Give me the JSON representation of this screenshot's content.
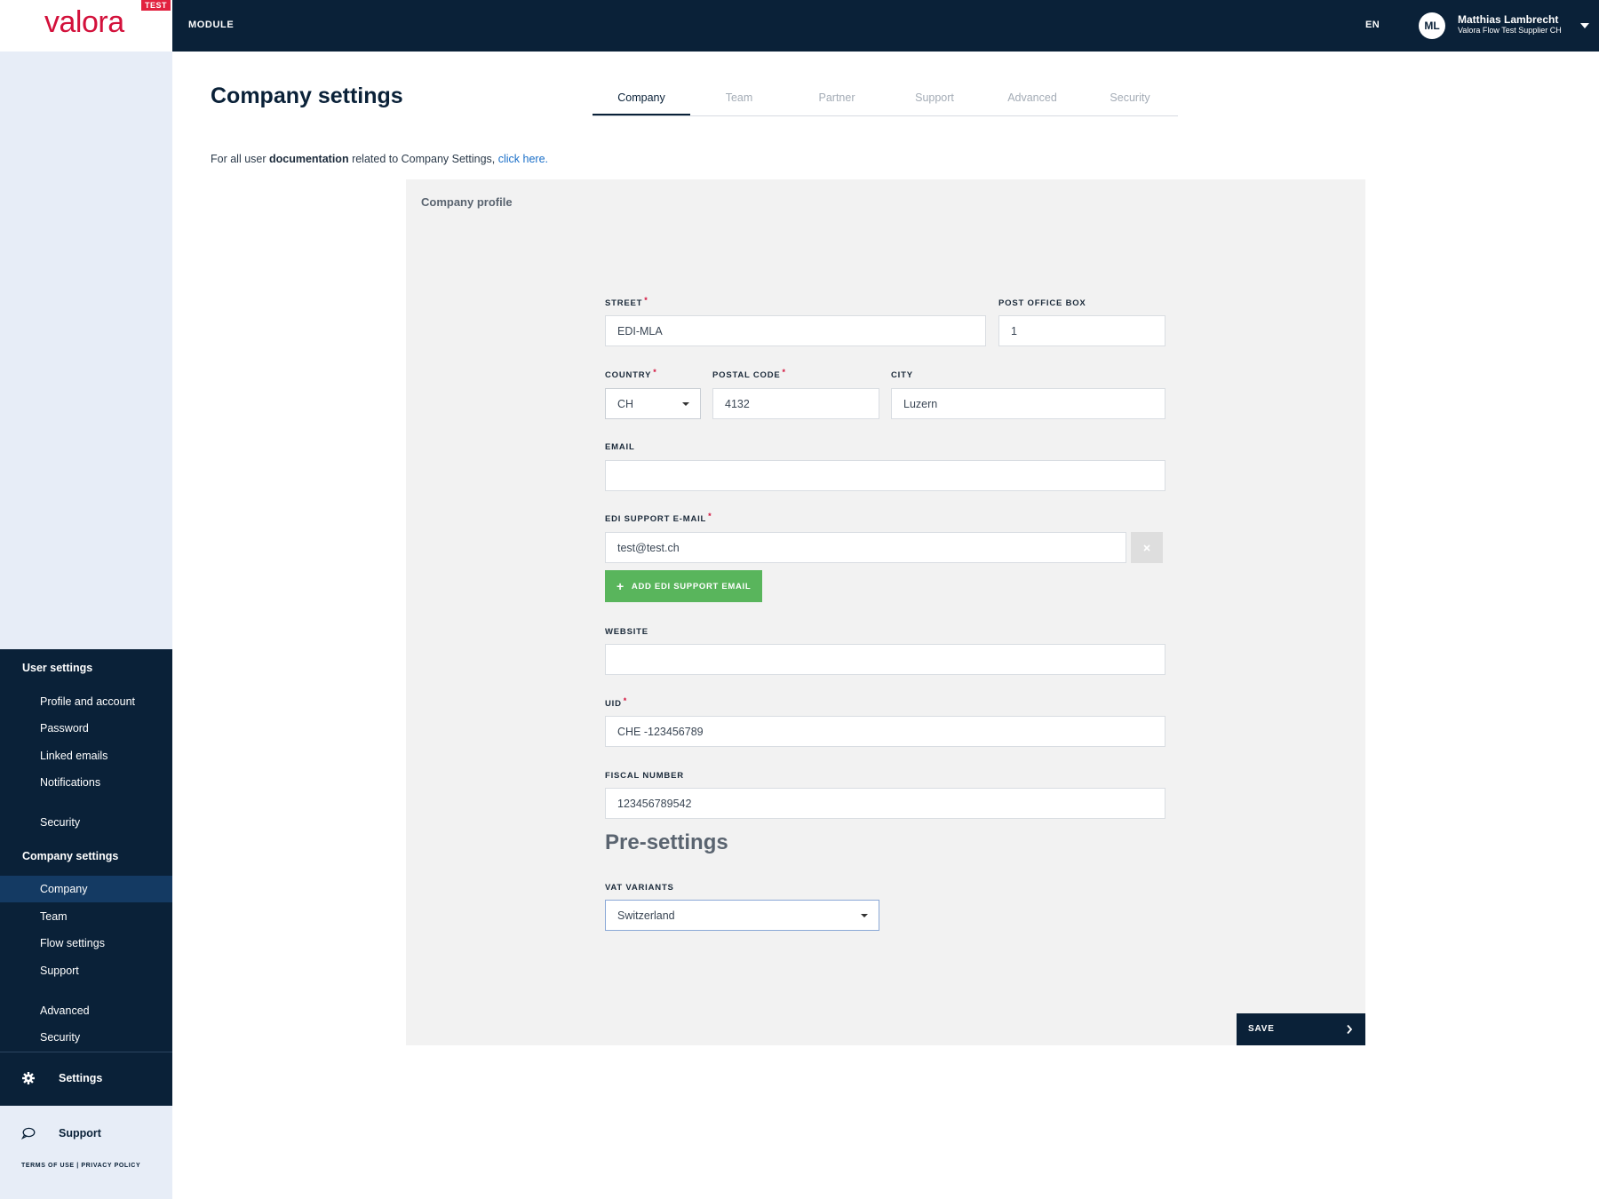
{
  "header": {
    "logo": "valora",
    "env_badge": "TEST",
    "module": "MODULE",
    "language": "EN",
    "user_initials": "ML",
    "user_name": "Matthias Lambrecht",
    "user_company": "Valora Flow Test Supplier CH"
  },
  "sidebar": {
    "user_settings": {
      "title": "User settings",
      "items": [
        "Profile and account",
        "Password",
        "Linked emails",
        "Notifications",
        "Security"
      ]
    },
    "company_settings": {
      "title": "Company settings",
      "items": [
        "Company",
        "Team",
        "Flow settings",
        "Support",
        "Advanced",
        "Security"
      ],
      "active": "Company"
    },
    "settings_label": "Settings",
    "support_label": "Support",
    "legal": "TERMS OF USE | PRIVACY POLICY"
  },
  "page": {
    "title": "Company settings",
    "tabs": [
      "Company",
      "Team",
      "Partner",
      "Support",
      "Advanced",
      "Security"
    ],
    "active_tab": "Company",
    "doc_prefix": "For all user ",
    "doc_bold": "documentation",
    "doc_middle": " related to Company Settings, ",
    "doc_link": "click here."
  },
  "form": {
    "panel_title": "Company profile",
    "street": {
      "label": "STREET",
      "value": "EDI-MLA"
    },
    "po_box": {
      "label": "POST OFFICE BOX",
      "value": "1"
    },
    "country": {
      "label": "COUNTRY",
      "value": "CH"
    },
    "postal_code": {
      "label": "POSTAL CODE",
      "value": "4132"
    },
    "city": {
      "label": "CITY",
      "value": "Luzern"
    },
    "email": {
      "label": "EMAIL",
      "value": ""
    },
    "edi_email": {
      "label": "EDI SUPPORT E-MAIL",
      "value": "test@test.ch"
    },
    "add_edi_button": "ADD EDI SUPPORT EMAIL",
    "website": {
      "label": "WEBSITE",
      "value": ""
    },
    "uid": {
      "label": "UID",
      "value": "CHE -123456789"
    },
    "fiscal": {
      "label": "FISCAL NUMBER",
      "value": "123456789542"
    },
    "presettings_title": "Pre-settings",
    "vat": {
      "label": "VAT VARIANTS",
      "value": "Switzerland"
    },
    "required_mark": "*",
    "save_button": "SAVE"
  },
  "colors": {
    "navy": "#0a2138",
    "brand_red": "#d3113b",
    "green": "#59b55c",
    "link_blue": "#1a6fc8"
  },
  "icons": {
    "user_menu": "chevron-down-icon",
    "settings": "gear-icon",
    "support": "chat-bubble-icon",
    "remove": "close-icon",
    "add": "plus-icon",
    "save": "chevron-right-icon"
  }
}
